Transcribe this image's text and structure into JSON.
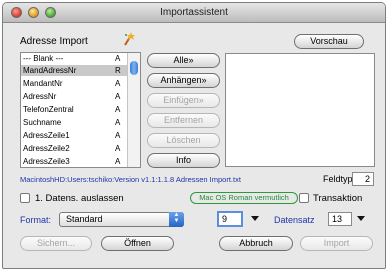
{
  "window": {
    "title": "Importassistent"
  },
  "header": {
    "address_label": "Adresse Import",
    "preview_button": "Vorschau"
  },
  "fields_list": {
    "rows": [
      {
        "name": "--- Blank ---",
        "type": "A",
        "selected": false
      },
      {
        "name": "MandAdressNr",
        "type": "R",
        "selected": true
      },
      {
        "name": "MandantNr",
        "type": "A",
        "selected": false
      },
      {
        "name": "AdressNr",
        "type": "A",
        "selected": false
      },
      {
        "name": "TelefonZentral",
        "type": "A",
        "selected": false
      },
      {
        "name": "Suchname",
        "type": "A",
        "selected": false
      },
      {
        "name": "AdressZeile1",
        "type": "A",
        "selected": false
      },
      {
        "name": "AdressZeile2",
        "type": "A",
        "selected": false
      },
      {
        "name": "AdressZeile3",
        "type": "A",
        "selected": false
      }
    ]
  },
  "actions": {
    "all": "Alle»",
    "append": "Anhängen»",
    "insert": "Einfügen»",
    "remove": "Entfernen",
    "delete": "Löschen",
    "info": "Info"
  },
  "status": {
    "file_text": "MacintoshHD:Users:tschiko:Version v1.1:1.1.8 Adressen Import.txt",
    "field_type_label": "Feldtyp",
    "field_type_value": "2"
  },
  "options": {
    "skip_first_label": "1. Datens. auslassen",
    "encoding_hint": "Mac OS Roman vermutlich",
    "transaction_label": "Transaktion"
  },
  "format": {
    "label": "Format:",
    "value": "Standard",
    "delimiter_value": "9",
    "record_label": "Datensatz",
    "record_value": "13"
  },
  "buttons": {
    "save": "Sichern...",
    "open": "Öffnen",
    "cancel": "Abbruch",
    "import": "Import"
  }
}
